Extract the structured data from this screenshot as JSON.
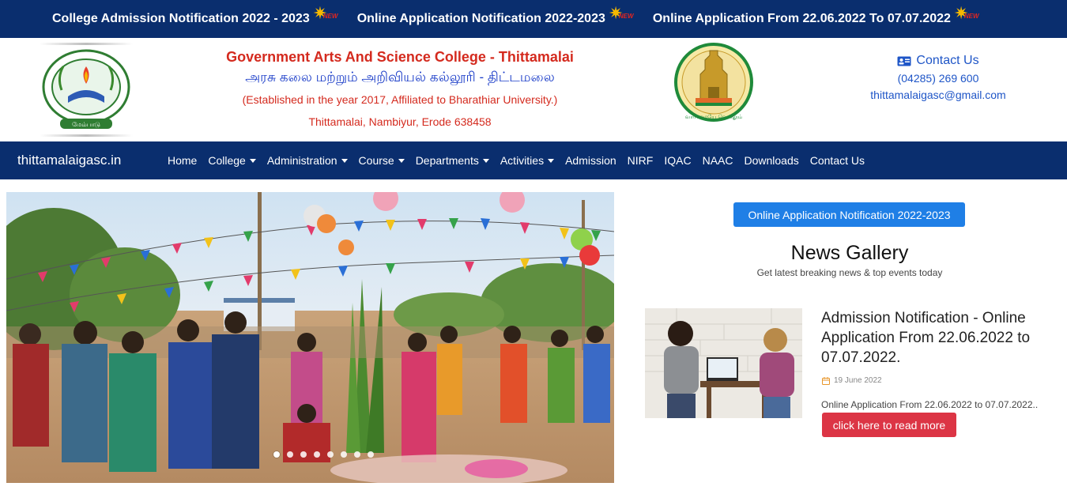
{
  "ticker": {
    "items": [
      "College Admission Notification 2022 - 2023",
      "Online Application Notification 2022-2023",
      "Online Application From 22.06.2022 To 07.07.2022"
    ],
    "badge": "NEW"
  },
  "header": {
    "college_name": "Government Arts And Science College - Thittamalai",
    "college_name_tamil": "அரசு கலை மற்றும் அறிவியல் கல்லூரி - திட்டமலை",
    "established": "(Established in the year 2017, Affiliated to Bharathiar University.)",
    "address": "Thittamalai, Nambiyur, Erode 638458",
    "logo_caption": "மேம்பாடு",
    "emblem_caption": "வாய்மையே வெல்லும்"
  },
  "contact": {
    "title": "Contact Us",
    "phone": "(04285) 269 600",
    "email": "thittamalaigasc@gmail.com"
  },
  "nav": {
    "brand": "thittamalaigasc.in",
    "items": [
      {
        "label": "Home",
        "dropdown": false
      },
      {
        "label": "College",
        "dropdown": true
      },
      {
        "label": "Administration",
        "dropdown": true
      },
      {
        "label": "Course",
        "dropdown": true
      },
      {
        "label": "Departments",
        "dropdown": true
      },
      {
        "label": "Activities",
        "dropdown": true
      },
      {
        "label": "Admission",
        "dropdown": false
      },
      {
        "label": "NIRF",
        "dropdown": false
      },
      {
        "label": "IQAC",
        "dropdown": false
      },
      {
        "label": "NAAC",
        "dropdown": false
      },
      {
        "label": "Downloads",
        "dropdown": false
      },
      {
        "label": "Contact Us",
        "dropdown": false
      }
    ]
  },
  "hero": {
    "slide_count": 8,
    "active_slide": 1
  },
  "sidebar": {
    "notification_button": "Online Application Notification 2022-2023",
    "news_title": "News Gallery",
    "news_subtitle": "Get latest breaking news & top events today",
    "news_item": {
      "headline": "Admission Notification - Online Application From 22.06.2022 to 07.07.2022.",
      "date": "19 June 2022",
      "excerpt": "Online Application From 22.06.2022 to 07.07.2022..",
      "button": "click here to read more"
    }
  },
  "colors": {
    "navy": "#0a2e6e",
    "red": "#d42a1e",
    "blue": "#1e55c7",
    "button_blue": "#1f7fe6",
    "button_red": "#dc3545"
  }
}
